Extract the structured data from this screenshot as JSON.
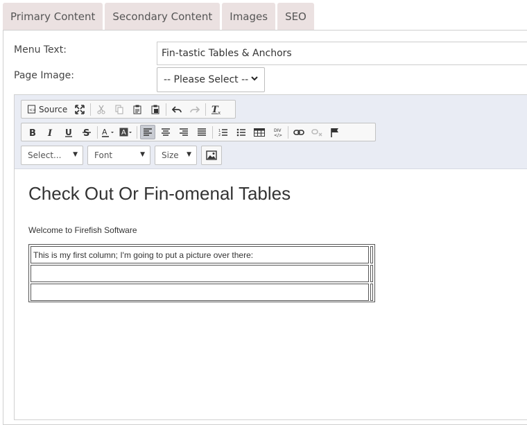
{
  "tabs": [
    "Primary Content",
    "Secondary Content",
    "Images",
    "SEO"
  ],
  "form": {
    "menu_text_label": "Menu Text:",
    "menu_text_value": "Fin-tastic Tables & Anchors",
    "page_image_label": "Page Image:",
    "page_image_value": "-- Please Select --"
  },
  "toolbar": {
    "source_label": "Source",
    "format_label": "Select...",
    "font_label": "Font",
    "size_label": "Size"
  },
  "editor": {
    "heading": "Check Out Or Fin-omenal Tables",
    "paragraph": "Welcome to Firefish Software",
    "table_rows": [
      "This is my first column; I'm going to put a picture over there:",
      "",
      ""
    ]
  }
}
